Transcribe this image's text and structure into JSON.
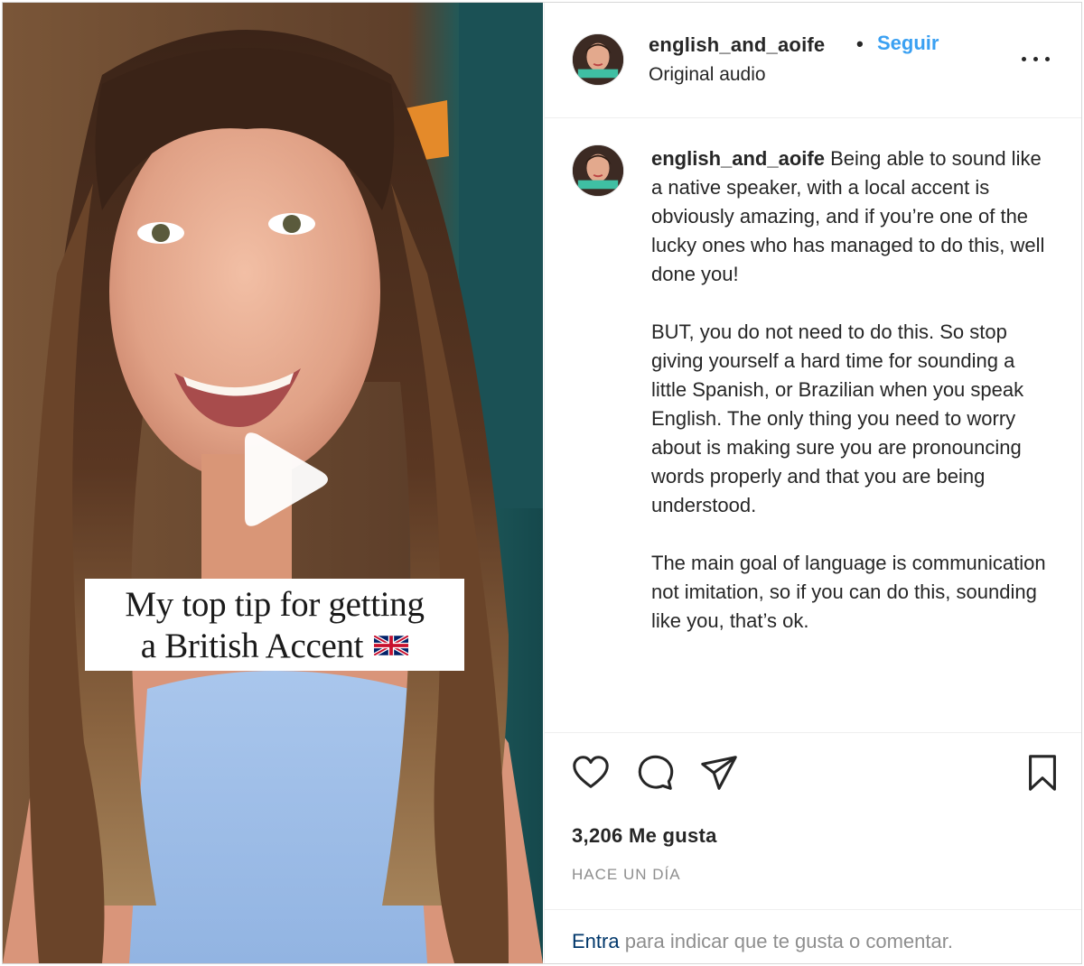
{
  "post": {
    "username": "english_and_aoife",
    "separator": "•",
    "follow_label": "Seguir",
    "audio_label": "Original audio",
    "more_label": "..."
  },
  "media": {
    "caption_line1": "My top tip for getting",
    "caption_line2": "a British Accent",
    "caption_flag": "uk-flag"
  },
  "caption": {
    "username": "english_and_aoife",
    "paragraphs": [
      "Being able to sound like a native speaker, with a local accent is obviously amazing, and if you’re one of the lucky ones who has managed to do this, well done you!",
      "BUT, you do not need to do this. So stop giving yourself a hard time for sounding a little Spanish, or Brazilian when you speak English. The only thing you need to worry about is making sure you are pronouncing words properly and that you are being understood.",
      "The main goal of language is communication not imitation, so if you can do this, sounding like you, that’s ok."
    ]
  },
  "actions": {
    "icons": [
      "heart-icon",
      "comment-icon",
      "share-icon",
      "bookmark-icon"
    ]
  },
  "likes": "3,206 Me gusta",
  "timestamp": "HACE UN DÍA",
  "login": {
    "link": "Entra",
    "rest": " para indicar que te gusta o comentar."
  },
  "colors": {
    "follow": "#3aa0f2",
    "text": "#262626",
    "muted": "#8e8e8e",
    "link": "#00376b"
  }
}
